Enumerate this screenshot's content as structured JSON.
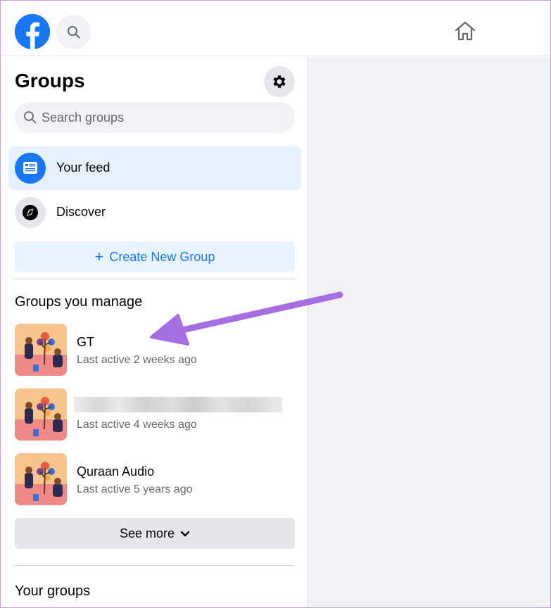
{
  "header": {
    "logo_icon": "facebook-logo-icon",
    "search_icon": "search-icon",
    "home_icon": "home-icon"
  },
  "sidebar": {
    "title": "Groups",
    "settings_icon": "gear-icon",
    "search": {
      "placeholder": "Search groups",
      "value": ""
    },
    "nav": [
      {
        "label": "Your feed",
        "icon": "feed-icon",
        "active": true
      },
      {
        "label": "Discover",
        "icon": "discover-icon",
        "active": false
      }
    ],
    "create_button": {
      "plus": "+",
      "label": "Create New Group"
    },
    "manage_section": {
      "title": "Groups you manage",
      "groups": [
        {
          "name": "GT",
          "last_active": "Last active 2 weeks ago"
        },
        {
          "name": "",
          "last_active": "Last active 4 weeks ago"
        },
        {
          "name": "Quraan Audio",
          "last_active": "Last active 5 years ago"
        }
      ]
    },
    "see_more": {
      "label": "See more",
      "icon": "chevron-down-icon"
    },
    "your_groups_title": "Your groups"
  },
  "colors": {
    "brand": "#1877f2",
    "active_bg": "#e7f0fd",
    "annotation_arrow": "#a66ee0"
  }
}
